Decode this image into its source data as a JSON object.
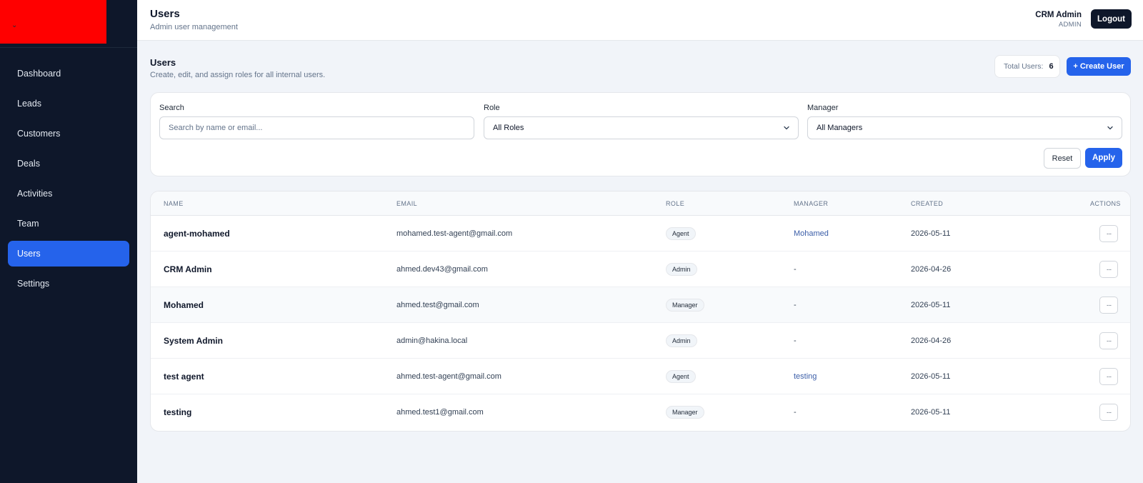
{
  "sidebar": {
    "logo_glyph": "⌄",
    "items": [
      {
        "label": "Dashboard",
        "active": false
      },
      {
        "label": "Leads",
        "active": false
      },
      {
        "label": "Customers",
        "active": false
      },
      {
        "label": "Deals",
        "active": false
      },
      {
        "label": "Activities",
        "active": false
      },
      {
        "label": "Team",
        "active": false
      },
      {
        "label": "Users",
        "active": true
      },
      {
        "label": "Settings",
        "active": false
      }
    ]
  },
  "header": {
    "title": "Users",
    "subtitle": "Admin user management",
    "user_name": "CRM Admin",
    "user_role": "ADMIN",
    "logout_label": "Logout"
  },
  "section": {
    "title": "Users",
    "subtitle": "Create, edit, and assign roles for all internal users.",
    "total_label": "Total Users:",
    "total_value": "6",
    "create_label": "+ Create User"
  },
  "filters": {
    "search_label": "Search",
    "search_placeholder": "Search by name or email...",
    "role_label": "Role",
    "role_value": "All Roles",
    "manager_label": "Manager",
    "manager_value": "All Managers",
    "reset_label": "Reset",
    "apply_label": "Apply"
  },
  "table": {
    "columns": [
      "NAME",
      "EMAIL",
      "ROLE",
      "MANAGER",
      "CREATED",
      "ACTIONS"
    ],
    "rows": [
      {
        "name": "agent-mohamed",
        "email": "mohamed.test-agent@gmail.com",
        "role": "Agent",
        "manager": "Mohamed",
        "created": "2026-05-11"
      },
      {
        "name": "CRM Admin",
        "email": "ahmed.dev43@gmail.com",
        "role": "Admin",
        "manager": "-",
        "created": "2026-04-26"
      },
      {
        "name": "Mohamed",
        "email": "ahmed.test@gmail.com",
        "role": "Manager",
        "manager": "-",
        "created": "2026-05-11"
      },
      {
        "name": "System Admin",
        "email": "admin@hakina.local",
        "role": "Admin",
        "manager": "-",
        "created": "2026-04-26"
      },
      {
        "name": "test agent",
        "email": "ahmed.test-agent@gmail.com",
        "role": "Agent",
        "manager": "testing",
        "created": "2026-05-11"
      },
      {
        "name": "testing",
        "email": "ahmed.test1@gmail.com",
        "role": "Manager",
        "manager": "-",
        "created": "2026-05-11"
      }
    ],
    "actions_glyph": "···"
  },
  "colors": {
    "sidebar_bg": "#0e172a",
    "accent": "#2563eb",
    "logo_bg": "#ff0000",
    "page_bg": "#f1f4f9"
  }
}
